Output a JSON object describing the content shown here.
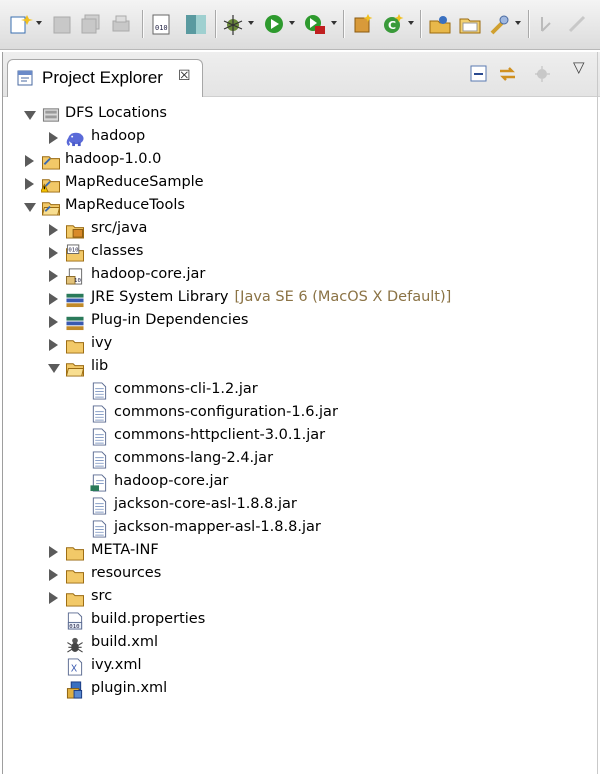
{
  "toolbar": {
    "buttons": [
      "new-wizard-icon",
      "save-icon",
      "save-all-icon",
      "print-icon",
      "binary-view-icon",
      "perspective-icon",
      "debug-icon",
      "run-icon",
      "external-tools-icon",
      "new-java-package-icon",
      "new-java-class-icon",
      "open-type-icon",
      "open-folder-icon",
      "search-pin-icon",
      "next-annotation-icon",
      "previous-annotation-icon"
    ]
  },
  "view": {
    "tab_title": "Project Explorer",
    "tab_close_glyph": "☒",
    "menu_glyph": "▽"
  },
  "tree": [
    {
      "label": "DFS Locations",
      "level": 0,
      "twisty": "open",
      "icon": "dfs-locations-icon"
    },
    {
      "label": "hadoop",
      "level": 1,
      "twisty": "closed",
      "icon": "hadoop-elephant-icon"
    },
    {
      "label": "hadoop-1.0.0",
      "level": 0,
      "twisty": "closed",
      "icon": "project-folder-icon"
    },
    {
      "label": "MapReduceSample",
      "level": 0,
      "twisty": "closed",
      "icon": "project-warning-icon"
    },
    {
      "label": "MapReduceTools",
      "level": 0,
      "twisty": "open",
      "icon": "project-folder-open-icon"
    },
    {
      "label": "src/java",
      "level": 1,
      "twisty": "closed",
      "icon": "source-folder-icon"
    },
    {
      "label": "classes",
      "level": 1,
      "twisty": "closed",
      "icon": "classes-folder-icon"
    },
    {
      "label": "hadoop-core.jar",
      "level": 1,
      "twisty": "closed",
      "icon": "jar-icon"
    },
    {
      "label": "JRE System Library",
      "decoration": "[Java SE 6 (MacOS X Default)]",
      "level": 1,
      "twisty": "closed",
      "icon": "library-icon"
    },
    {
      "label": "Plug-in Dependencies",
      "level": 1,
      "twisty": "closed",
      "icon": "library-icon"
    },
    {
      "label": "ivy",
      "level": 1,
      "twisty": "closed",
      "icon": "folder-icon"
    },
    {
      "label": "lib",
      "level": 1,
      "twisty": "open",
      "icon": "folder-open-icon"
    },
    {
      "label": "commons-cli-1.2.jar",
      "level": 2,
      "twisty": "none",
      "icon": "file-icon"
    },
    {
      "label": "commons-configuration-1.6.jar",
      "level": 2,
      "twisty": "none",
      "icon": "file-icon"
    },
    {
      "label": "commons-httpclient-3.0.1.jar",
      "level": 2,
      "twisty": "none",
      "icon": "file-icon"
    },
    {
      "label": "commons-lang-2.4.jar",
      "level": 2,
      "twisty": "none",
      "icon": "file-icon"
    },
    {
      "label": "hadoop-core.jar",
      "level": 2,
      "twisty": "none",
      "icon": "jar-file-icon"
    },
    {
      "label": "jackson-core-asl-1.8.8.jar",
      "level": 2,
      "twisty": "none",
      "icon": "file-icon"
    },
    {
      "label": "jackson-mapper-asl-1.8.8.jar",
      "level": 2,
      "twisty": "none",
      "icon": "file-icon"
    },
    {
      "label": "META-INF",
      "level": 1,
      "twisty": "closed",
      "icon": "folder-icon"
    },
    {
      "label": "resources",
      "level": 1,
      "twisty": "closed",
      "icon": "folder-icon"
    },
    {
      "label": "src",
      "level": 1,
      "twisty": "closed",
      "icon": "folder-icon"
    },
    {
      "label": "build.properties",
      "level": 1,
      "twisty": "none",
      "icon": "properties-file-icon"
    },
    {
      "label": "build.xml",
      "level": 1,
      "twisty": "none",
      "icon": "ant-file-icon"
    },
    {
      "label": "ivy.xml",
      "level": 1,
      "twisty": "none",
      "icon": "xml-file-icon"
    },
    {
      "label": "plugin.xml",
      "level": 1,
      "twisty": "none",
      "icon": "plugin-file-icon"
    }
  ]
}
